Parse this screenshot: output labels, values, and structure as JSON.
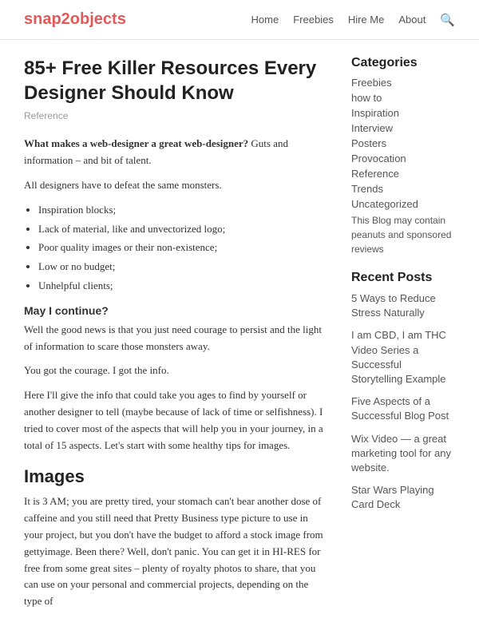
{
  "header": {
    "logo": "snap2objects",
    "nav": {
      "items": [
        "Home",
        "Freebies",
        "Hire Me",
        "About"
      ]
    }
  },
  "article": {
    "title": "85+ Free Killer Resources Every Designer Should Know",
    "tag": "Reference",
    "intro_bold": "What makes a web-designer a great web-designer?",
    "intro_rest": " Guts and information – and bit of talent.",
    "para1": "All designers have to defeat the same monsters.",
    "bullets": [
      "Inspiration blocks;",
      "Lack of material, like and unvectorized logo;",
      "Poor quality images or their non-existence;",
      "Low or no budget;",
      "Unhelpful clients;"
    ],
    "subheading1": "May I continue?",
    "para2": "Well the good news is that you just need courage to persist and the light of information to scare those monsters away.",
    "para3": "You got the courage. I got the info.",
    "para4": "Here I'll give the info that could take you ages to find by yourself or another designer to tell (maybe because of lack of time or selfishness). I tried to cover most of the aspects that will help you in your journey, in a total of 15 aspects. Let's start with some healthy tips for images.",
    "section_images": "Images",
    "para5": "It is 3 AM; you are pretty tired, your stomach can't bear another dose of caffeine and you still need that Pretty Business type picture to use in your project, but you don't have the budget to afford a stock image from gettyimage. Been there? Well, don't panic. You can get it in HI-RES for free from some great sites – plenty of royalty photos to share, that you can use on your personal and commercial projects, depending on the type of"
  },
  "sidebar": {
    "categories_title": "Categories",
    "categories": [
      "Freebies",
      "how to",
      "Inspiration",
      "Interview",
      "Posters",
      "Provocation",
      "Reference",
      "Trends",
      "Uncategorized"
    ],
    "note": "This Blog may contain peanuts and sponsored reviews",
    "recent_title": "Recent Posts",
    "recent_posts": [
      "5 Ways to Reduce Stress Naturally",
      "I am CBD, I am THC Video Series a Successful Storytelling Example",
      "Five Aspects of a Successful Blog Post",
      "Wix Video — a great marketing tool for any website.",
      "Star Wars Playing Card Deck"
    ]
  }
}
